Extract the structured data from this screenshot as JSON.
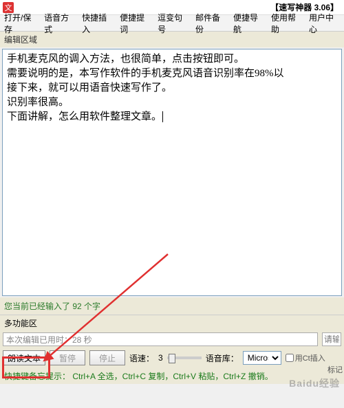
{
  "titlebar": {
    "icon_text": "文",
    "title": "【速写神器 3.06】"
  },
  "menu": {
    "items": [
      "打开/保存",
      "语音方式",
      "快捷插入",
      "便捷提词",
      "逗变句号",
      "邮件备份",
      "便捷导航",
      "使用帮助",
      "用户中心"
    ]
  },
  "edit_section": {
    "label": "编辑区域",
    "lines": [
      "手机麦克风的调入方法，也很简单，点击按钮即可。",
      "需要说明的是，本写作软件的手机麦克风语音识别率在98%以",
      "接下来，就可以用语音快速写作了。",
      "识别率很高。",
      "下面讲解，怎么用软件整理文章。"
    ]
  },
  "char_count": {
    "prefix": "您当前已经输入了 ",
    "count": "92",
    "suffix": " 个字"
  },
  "multi_section": {
    "label": "多功能区"
  },
  "timer": {
    "text": "本次编辑已用时：28 秒",
    "right_placeholder": "请输"
  },
  "controls": {
    "read_btn": "朗读文本",
    "pause_btn": "暂停",
    "stop_btn": "停止",
    "speed_label": "语速：",
    "speed_value": "3",
    "voice_label": "语音库：",
    "voice_selected": "Microsof",
    "checkbox1": "用Ct插入",
    "side_label": "标记"
  },
  "hints": {
    "text": "快捷键备忘提示： Ctrl+A 全选，Ctrl+C 复制，Ctrl+V 粘贴，Ctrl+Z 撤销。"
  },
  "watermark": "Baidu经验"
}
